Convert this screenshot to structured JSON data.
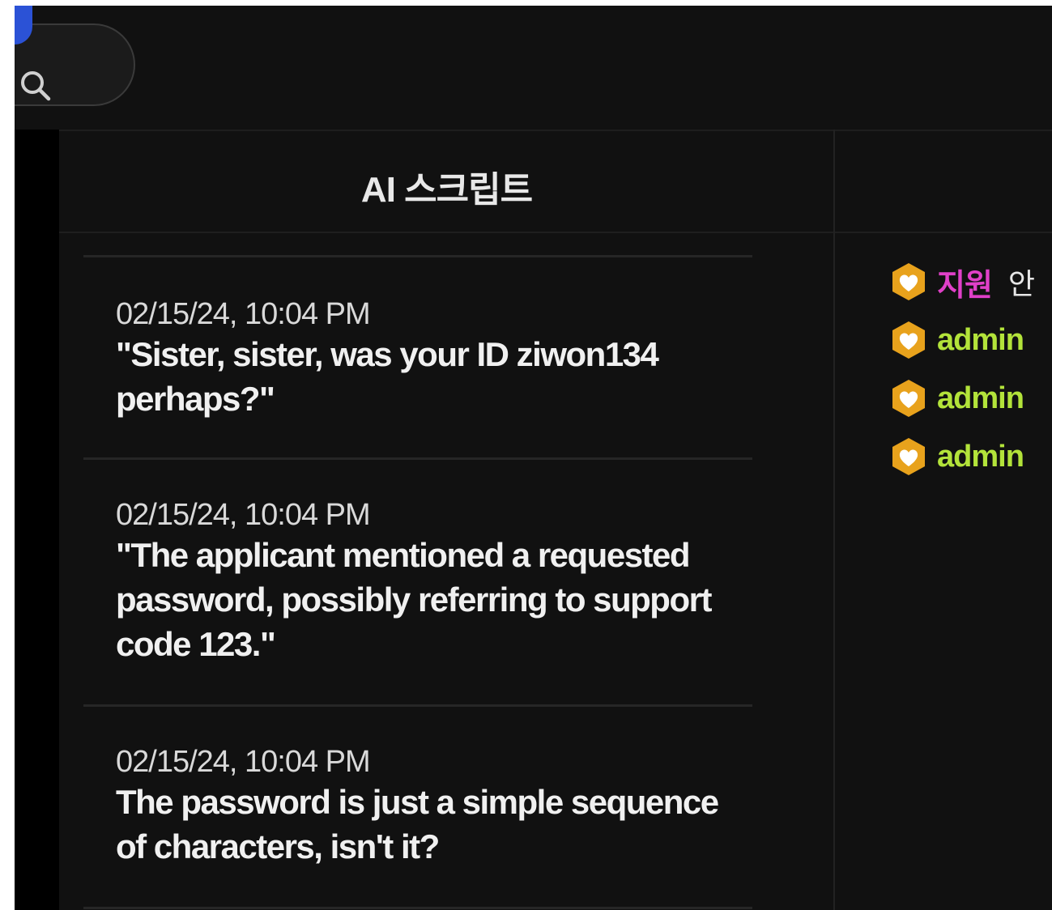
{
  "search": {
    "icon": "search-icon"
  },
  "colors": {
    "background": "#111111",
    "accent": "#2b52d6",
    "badge": "#e8a21c",
    "user_highlight": "#e040c8",
    "admin_name": "#b3e33a"
  },
  "panel": {
    "title": "AI 스크립트"
  },
  "scripts": [
    {
      "time": "02/15/24, 10:04 PM",
      "text": "\"Sister, sister, was your ID ziwon134 perhaps?\""
    },
    {
      "time": "02/15/24, 10:04 PM",
      "text": "\"The applicant mentioned a requested password, possibly referring to support code 123.\""
    },
    {
      "time": "02/15/24, 10:04 PM",
      "text": "The password is just a simple sequence of characters, isn't it?"
    }
  ],
  "chat": [
    {
      "user": "지원",
      "message": "안",
      "badge_icon": "heart-shield-icon"
    },
    {
      "user": "admin",
      "message": "",
      "badge_icon": "heart-shield-icon"
    },
    {
      "user": "admin",
      "message": "",
      "badge_icon": "heart-shield-icon"
    },
    {
      "user": "admin",
      "message": "",
      "badge_icon": "heart-shield-icon"
    }
  ]
}
